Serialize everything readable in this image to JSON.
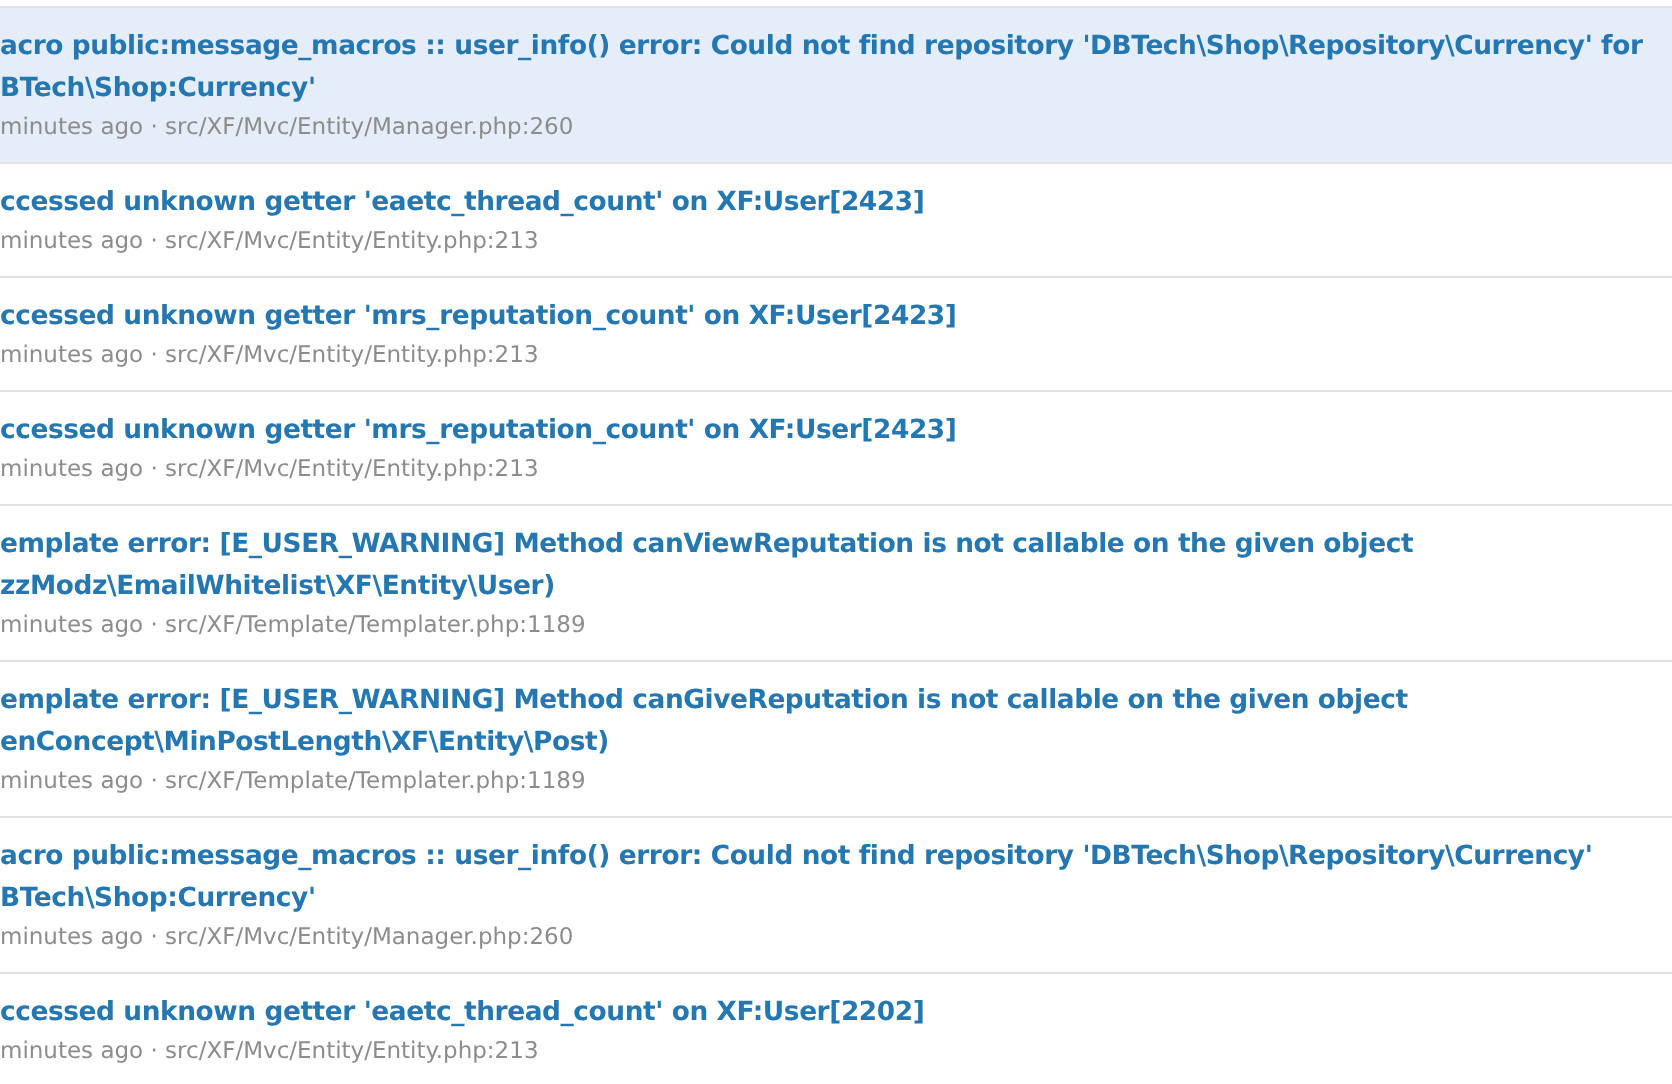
{
  "log_entries": [
    {
      "selected": true,
      "title_lines": [
        "acro public:message_macros :: user_info() error: Could not find repository 'DBTech\\Shop\\Repository\\Currency' for",
        "BTech\\Shop:Currency'"
      ],
      "meta": "minutes ago · src/XF/Mvc/Entity/Manager.php:260"
    },
    {
      "selected": false,
      "title_lines": [
        "ccessed unknown getter 'eaetc_thread_count' on XF:User[2423]"
      ],
      "meta": "minutes ago · src/XF/Mvc/Entity/Entity.php:213"
    },
    {
      "selected": false,
      "title_lines": [
        "ccessed unknown getter 'mrs_reputation_count' on XF:User[2423]"
      ],
      "meta": "minutes ago · src/XF/Mvc/Entity/Entity.php:213"
    },
    {
      "selected": false,
      "title_lines": [
        "ccessed unknown getter 'mrs_reputation_count' on XF:User[2423]"
      ],
      "meta": "minutes ago · src/XF/Mvc/Entity/Entity.php:213"
    },
    {
      "selected": false,
      "title_lines": [
        "emplate error: [E_USER_WARNING] Method canViewReputation is not callable on the given object",
        "zzModz\\EmailWhitelist\\XF\\Entity\\User)"
      ],
      "meta": "minutes ago · src/XF/Template/Templater.php:1189"
    },
    {
      "selected": false,
      "title_lines": [
        "emplate error: [E_USER_WARNING] Method canGiveReputation is not callable on the given object",
        "enConcept\\MinPostLength\\XF\\Entity\\Post)"
      ],
      "meta": "minutes ago · src/XF/Template/Templater.php:1189"
    },
    {
      "selected": false,
      "title_lines": [
        "acro public:message_macros :: user_info() error: Could not find repository 'DBTech\\Shop\\Repository\\Currency'",
        "BTech\\Shop:Currency'"
      ],
      "meta": "minutes ago · src/XF/Mvc/Entity/Manager.php:260"
    },
    {
      "selected": false,
      "title_lines": [
        "ccessed unknown getter 'eaetc_thread_count' on XF:User[2202]"
      ],
      "meta": "minutes ago · src/XF/Mvc/Entity/Entity.php:213"
    }
  ]
}
